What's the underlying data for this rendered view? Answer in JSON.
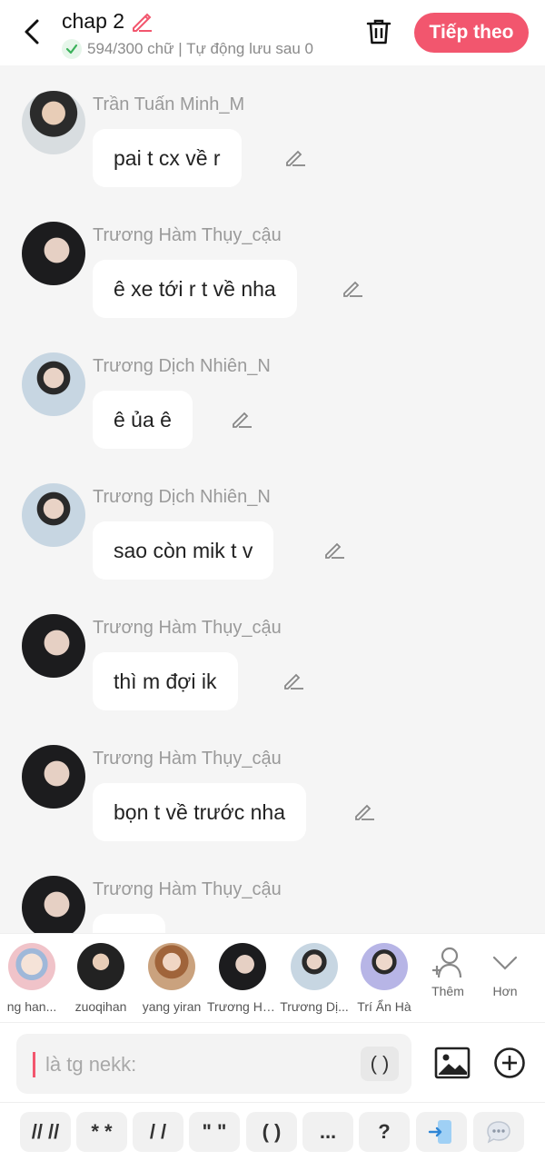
{
  "header": {
    "title": "chap 2",
    "status": "594/300 chữ | Tự động lưu sau 0",
    "next_label": "Tiếp theo"
  },
  "messages": [
    {
      "sender": "Trần Tuấn Minh_M",
      "text": "pai t cx về r"
    },
    {
      "sender": "Trương Hàm Thụy_cậu",
      "text": "ê xe tới r t về nha"
    },
    {
      "sender": "Trương Dịch Nhiên_N",
      "text": "ê ủa ê"
    },
    {
      "sender": "Trương Dịch Nhiên_N",
      "text": "sao còn mik t v"
    },
    {
      "sender": "Trương Hàm Thụy_cậu",
      "text": "thì m đợi ik"
    },
    {
      "sender": "Trương Hàm Thụy_cậu",
      "text": "bọn t về trước nha"
    },
    {
      "sender": "Trương Hàm Thụy_cậu",
      "text": ""
    }
  ],
  "characters": [
    {
      "name": "ng han..."
    },
    {
      "name": "zuoqihan"
    },
    {
      "name": "yang yiran"
    },
    {
      "name": "Trương Hà..."
    },
    {
      "name": "Trương Dị..."
    },
    {
      "name": "Trí Ẩn Hà"
    }
  ],
  "character_bar": {
    "add_label": "Thêm",
    "more_label": "Hơn"
  },
  "input": {
    "placeholder": "là tg nekk:",
    "paren_label": "( )"
  },
  "format_buttons": [
    "// //",
    "* *",
    "/ /",
    "\" \"",
    "( )",
    "...",
    "?"
  ],
  "colors": {
    "accent": "#f2566e",
    "background": "#f5f5f5"
  }
}
